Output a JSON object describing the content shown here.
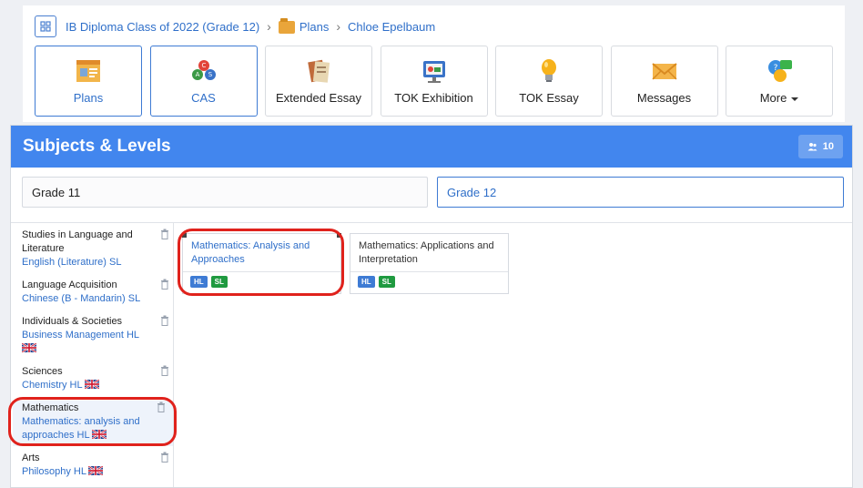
{
  "breadcrumb": {
    "items": [
      {
        "label": "IB Diploma Class of 2022 (Grade 12)"
      },
      {
        "label": "Plans"
      },
      {
        "label": "Chloe Epelbaum"
      }
    ]
  },
  "tiles": [
    {
      "label": "Plans",
      "icon": "plans-icon",
      "active": true
    },
    {
      "label": "CAS",
      "icon": "cas-icon",
      "active": true
    },
    {
      "label": "Extended Essay",
      "icon": "extended-essay-icon"
    },
    {
      "label": "TOK Exhibition",
      "icon": "tok-exhibition-icon"
    },
    {
      "label": "TOK Essay",
      "icon": "lightbulb-icon"
    },
    {
      "label": "Messages",
      "icon": "envelope-icon"
    },
    {
      "label": "More",
      "icon": "chat-bubbles-icon"
    }
  ],
  "panel": {
    "title": "Subjects & Levels",
    "count": "10",
    "grades": [
      "Grade 11",
      "Grade 12"
    ]
  },
  "subjects": [
    {
      "group": "Studies in Language and Literature",
      "value": "English (Literature) SL"
    },
    {
      "group": "Language Acquisition",
      "value": "Chinese (B - Mandarin) SL"
    },
    {
      "group": "Individuals & Societies",
      "value": "Business Management HL"
    },
    {
      "group": "Sciences",
      "value": "Chemistry HL"
    },
    {
      "group": "Mathematics",
      "value": "Mathematics: analysis and approaches HL"
    },
    {
      "group": "Arts",
      "value": "Philosophy HL"
    }
  ],
  "options": [
    {
      "name": "Mathematics: Analysis and Approaches",
      "levels": [
        "HL",
        "SL"
      ]
    },
    {
      "name": "Mathematics: Applications and Interpretation",
      "levels": [
        "HL",
        "SL"
      ]
    }
  ],
  "colors": {
    "accent": "#4286ee",
    "link": "#2f6fc9",
    "hl": "#3e7bd4",
    "sl": "#1f9a40",
    "annotation": "#e0221c"
  }
}
